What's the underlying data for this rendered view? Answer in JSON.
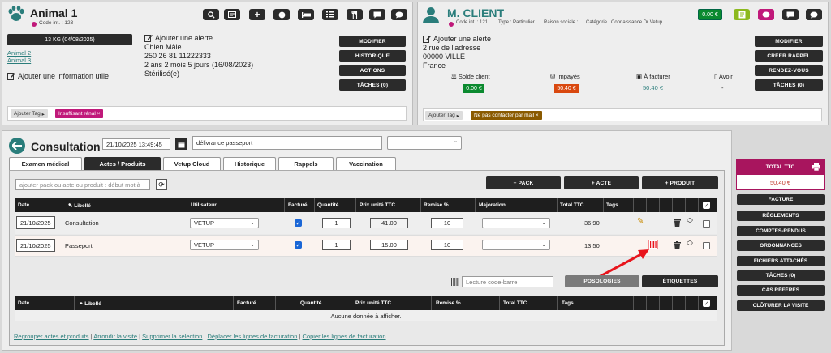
{
  "animal": {
    "name": "Animal 1",
    "code": "Code int. : 123",
    "weight": "13 KG (04/08/2025)",
    "links": [
      "Animal 2",
      "Animal 3"
    ],
    "add_info": "Ajouter une information utile",
    "alert": "Ajouter une alerte",
    "lines": [
      "Chien Mâle",
      "250 26 81 11222333",
      "2 ans 2 mois 5 jours (16/08/2023)",
      "Stérilisé(e)"
    ],
    "buttons": [
      "MODIFIER",
      "HISTORIQUE",
      "ACTIONS",
      "TÂCHES (0)"
    ],
    "add_tag": "Ajouter Tag",
    "tag": "Insuffisant rénal"
  },
  "client": {
    "name": "M. CLIENT",
    "code": "Code int. : 121",
    "type": "Type : Particulier",
    "raison": "Raison sociale :",
    "categorie": "Catégorie : Connaissance Dr Vetup",
    "balance": "0.00 €",
    "alert": "Ajouter une alerte",
    "address": [
      "2 rue de l'adresse",
      "00000 VILLE",
      "France"
    ],
    "stats": [
      {
        "label": "Solde client",
        "value": "0.00 €"
      },
      {
        "label": "Impayés",
        "value": "50.40 €"
      },
      {
        "label": "À facturer",
        "value": "50.40 €"
      },
      {
        "label": "Avoir",
        "value": "-"
      }
    ],
    "buttons": [
      "MODIFIER",
      "CRÉER RAPPEL",
      "RENDEZ-VOUS",
      "TÂCHES (0)"
    ],
    "add_tag": "Ajouter Tag",
    "tag": "Ne pas contacter par mail"
  },
  "consultation": {
    "title": "Consultation",
    "datetime": "21/10/2025 13:49:45",
    "reason": "délivrance passeport",
    "tabs": [
      "Examen médical",
      "Actes / Produits",
      "Vetup Cloud",
      "Historique",
      "Rappels",
      "Vaccination"
    ],
    "search_placeholder": "ajouter pack ou acte ou produit : début mot à",
    "btn_pack": "+ PACK",
    "btn_acte": "+ ACTE",
    "btn_produit": "+ PRODUIT",
    "columns": [
      "Date",
      "Libellé",
      "Utilisateur",
      "Facturé",
      "Quantité",
      "Prix unité TTC",
      "Remise %",
      "Majoration",
      "Total TTC",
      "Tags"
    ],
    "rows": [
      {
        "date": "21/10/2025",
        "label": "Consultation",
        "user": "VETUP",
        "qty": "1",
        "price": "41.00",
        "discount": "10",
        "total": "36.90"
      },
      {
        "date": "21/10/2025",
        "label": "Passeport",
        "user": "VETUP",
        "qty": "1",
        "price": "15.00",
        "discount": "10",
        "total": "13.50"
      }
    ],
    "barcode_placeholder": "Lecture code-barre",
    "btn_posologies": "POSOLOGIES",
    "btn_etiquettes": "ÉTIQUETTES",
    "columns2": [
      "Date",
      "Libellé",
      "Facturé",
      "Quantité",
      "Prix unité TTC",
      "Remise %",
      "Total TTC",
      "Tags"
    ],
    "empty": "Aucune donnée à afficher.",
    "footer_links": [
      "Regrouper actes et produits",
      "Arrondir la visite",
      "Supprimer la sélection",
      "Déplacer les lignes de facturation",
      "Copier les lignes de facturation"
    ]
  },
  "right": {
    "total_label": "TOTAL TTC",
    "total_value": "50.40 €",
    "buttons": [
      "FACTURE",
      "RÈGLEMENTS",
      "COMPTES-RENDUS",
      "ORDONNANCES",
      "FICHIERS ATTACHÉS",
      "TÂCHES (0)",
      "CAS RÉFÉRÉS",
      "CLÔTURER LA VISITE"
    ]
  },
  "colors": {
    "accent": "#2a7d7b",
    "pink": "#c0197a",
    "total_bg": "#a8155e",
    "arrow": "#e8141c"
  }
}
